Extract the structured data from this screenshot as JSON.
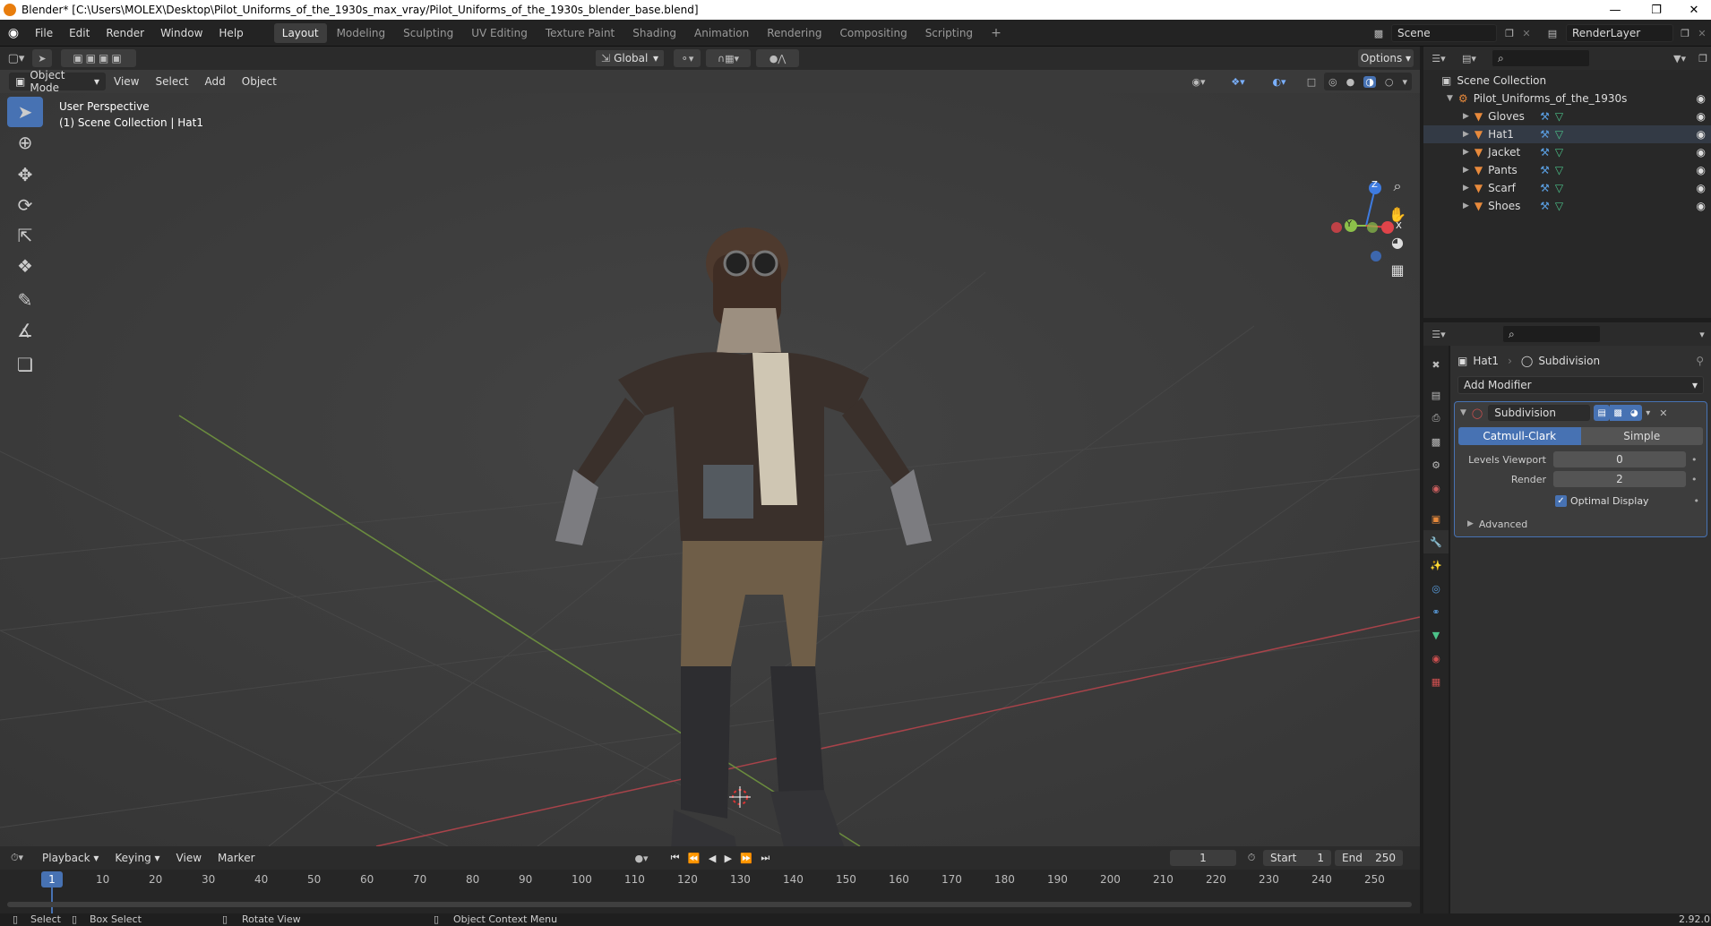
{
  "window": {
    "title": "Blender* [C:\\Users\\MOLEX\\Desktop\\Pilot_Uniforms_of_the_1930s_max_vray/Pilot_Uniforms_of_the_1930s_blender_base.blend]",
    "minimize": "—",
    "maximize": "❐",
    "close": "✕"
  },
  "menubar": {
    "items": [
      "File",
      "Edit",
      "Render",
      "Window",
      "Help"
    ]
  },
  "workspaces": {
    "tabs": [
      "Layout",
      "Modeling",
      "Sculpting",
      "UV Editing",
      "Texture Paint",
      "Shading",
      "Animation",
      "Rendering",
      "Compositing",
      "Scripting"
    ],
    "active": "Layout",
    "add": "+"
  },
  "scene": {
    "name": "Scene",
    "render_layer": "RenderLayer"
  },
  "viewport_header": {
    "mode": "Object Mode",
    "menus": [
      "View",
      "Select",
      "Add",
      "Object"
    ],
    "transform_orientation": "Global",
    "options": "Options"
  },
  "viewport": {
    "perspective": "User Perspective",
    "collection_info": "(1) Scene Collection | Hat1",
    "gizmo_labels": {
      "z": "Z",
      "y": "Y",
      "x": "X"
    },
    "grid_color": "#444444",
    "x_axis_color": "#c0444a",
    "y_axis_color": "#7ea34a"
  },
  "outliner": {
    "root": "Scene Collection",
    "collection": "Pilot_Uniforms_of_the_1930s",
    "objects": [
      "Gloves",
      "Hat1",
      "Jacket",
      "Pants",
      "Scarf",
      "Shoes"
    ],
    "selected": "Hat1"
  },
  "properties": {
    "breadcrumb_object": "Hat1",
    "breadcrumb_modifier": "Subdivision",
    "add_modifier": "Add Modifier",
    "modifier": {
      "name": "Subdivision",
      "types": [
        "Catmull-Clark",
        "Simple"
      ],
      "active_type": "Catmull-Clark",
      "levels_viewport_label": "Levels Viewport",
      "levels_viewport": "0",
      "render_label": "Render",
      "render": "2",
      "optimal_display_label": "Optimal Display",
      "optimal_display": true,
      "advanced": "Advanced"
    }
  },
  "timeline": {
    "menus": [
      "Playback",
      "Keying",
      "View",
      "Marker"
    ],
    "current_frame": "1",
    "start_label": "Start",
    "start": "1",
    "end_label": "End",
    "end": "250",
    "ticks": [
      "10",
      "20",
      "30",
      "40",
      "50",
      "60",
      "70",
      "80",
      "90",
      "100",
      "110",
      "120",
      "130",
      "140",
      "150",
      "160",
      "170",
      "180",
      "190",
      "200",
      "210",
      "220",
      "230",
      "240",
      "250"
    ],
    "playhead": "1"
  },
  "statusbar": {
    "select": "Select",
    "box_select": "Box Select",
    "rotate_view": "Rotate View",
    "context_menu": "Object Context Menu",
    "version": "2.92.0"
  },
  "colors": {
    "accent": "#4772b3",
    "object_orange": "#e88a3c",
    "modifier_blue": "#5a9ee0",
    "mesh_green": "#4cc38a"
  }
}
